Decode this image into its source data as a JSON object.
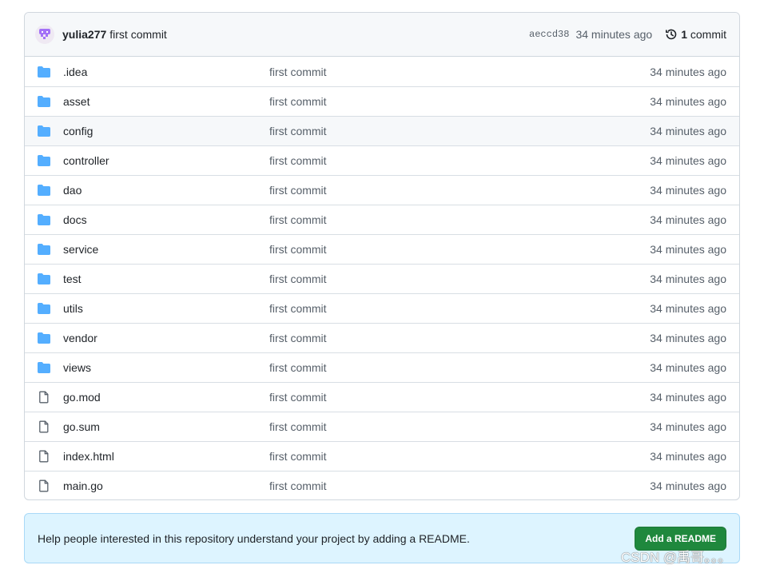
{
  "latest_commit": {
    "author": "yulia277",
    "message": "first commit",
    "sha": "aeccd38",
    "time": "34 minutes ago",
    "commit_count": "1",
    "commit_label": "commit",
    "history_icon": "history-icon"
  },
  "files": [
    {
      "name": ".idea",
      "type": "folder",
      "commit": "first commit",
      "time": "34 minutes ago"
    },
    {
      "name": "asset",
      "type": "folder",
      "commit": "first commit",
      "time": "34 minutes ago"
    },
    {
      "name": "config",
      "type": "folder",
      "commit": "first commit",
      "time": "34 minutes ago"
    },
    {
      "name": "controller",
      "type": "folder",
      "commit": "first commit",
      "time": "34 minutes ago"
    },
    {
      "name": "dao",
      "type": "folder",
      "commit": "first commit",
      "time": "34 minutes ago"
    },
    {
      "name": "docs",
      "type": "folder",
      "commit": "first commit",
      "time": "34 minutes ago"
    },
    {
      "name": "service",
      "type": "folder",
      "commit": "first commit",
      "time": "34 minutes ago"
    },
    {
      "name": "test",
      "type": "folder",
      "commit": "first commit",
      "time": "34 minutes ago"
    },
    {
      "name": "utils",
      "type": "folder",
      "commit": "first commit",
      "time": "34 minutes ago"
    },
    {
      "name": "vendor",
      "type": "folder",
      "commit": "first commit",
      "time": "34 minutes ago"
    },
    {
      "name": "views",
      "type": "folder",
      "commit": "first commit",
      "time": "34 minutes ago"
    },
    {
      "name": "go.mod",
      "type": "file",
      "commit": "first commit",
      "time": "34 minutes ago"
    },
    {
      "name": "go.sum",
      "type": "file",
      "commit": "first commit",
      "time": "34 minutes ago"
    },
    {
      "name": "index.html",
      "type": "file",
      "commit": "first commit",
      "time": "34 minutes ago"
    },
    {
      "name": "main.go",
      "type": "file",
      "commit": "first commit",
      "time": "34 minutes ago"
    }
  ],
  "readme_banner": {
    "text": "Help people interested in this repository understand your project by adding a README.",
    "button": "Add a README"
  },
  "watermark": "CSDN @禹哥。。。",
  "colors": {
    "folder": "#54aeff",
    "button": "#1f883d",
    "banner_bg": "#ddf4ff"
  }
}
